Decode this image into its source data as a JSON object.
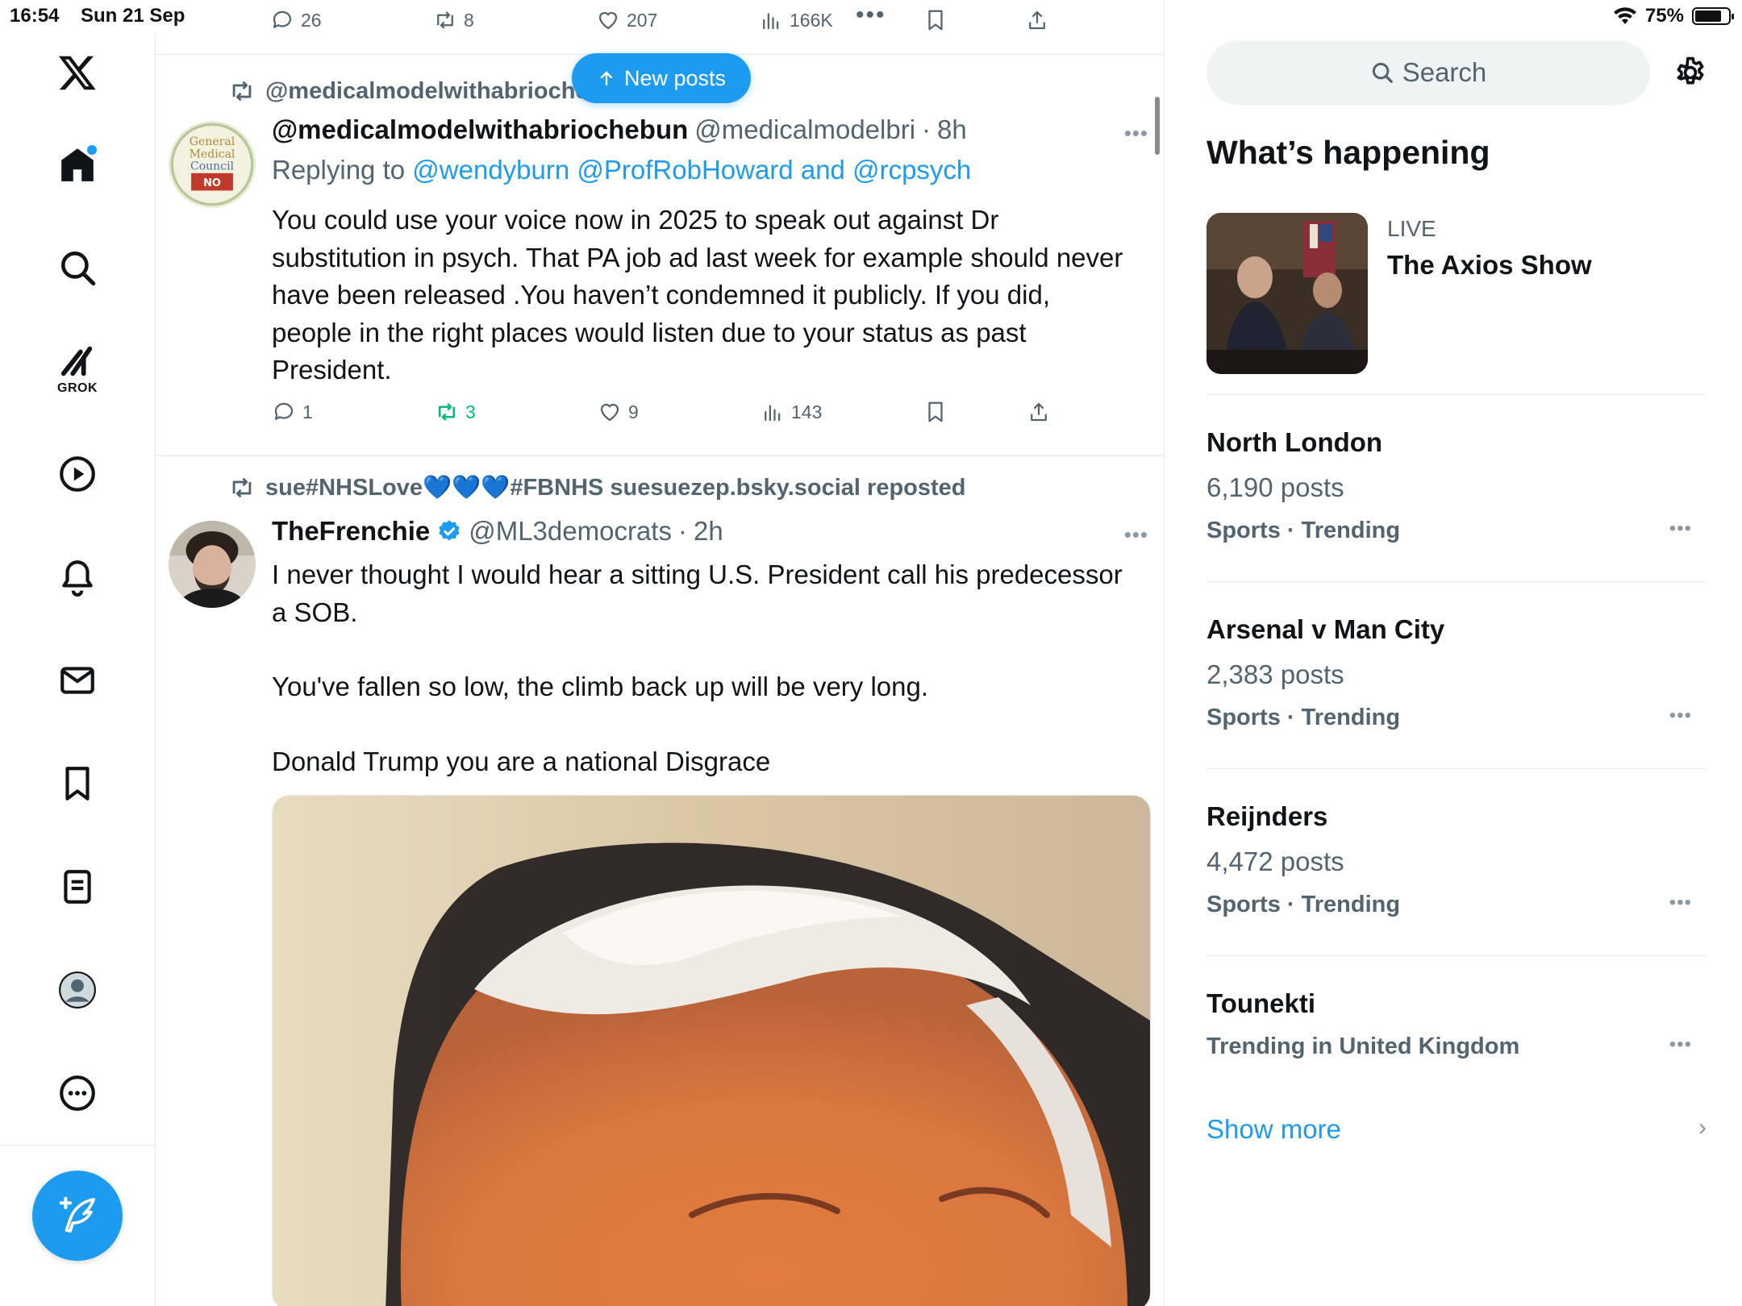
{
  "status_bar": {
    "time": "16:54",
    "date": "Sun 21 Sep",
    "battery": "75%"
  },
  "top_actions": {
    "replies": "26",
    "reposts": "8",
    "likes": "207",
    "views": "166K"
  },
  "new_posts": "New posts",
  "tweet1": {
    "repost_text": "@medicalmodelwithabriochebun reposted",
    "name": "@medicalmodelwithabriochebun",
    "handle": "@medicalmodelbri",
    "time": "8h",
    "replying_prefix": "Replying to",
    "replying_handles": "@wendyburn @ProfRobHoward",
    "replying_and": "and",
    "replying_last": "@rcpsych",
    "body": "You could use your voice now in 2025 to speak out against Dr substitution in psych. That PA job ad last week for example should never have been released .You haven’t condemned it publicly. If you did, people in the right places would listen due to your status as past President.",
    "replies": "1",
    "reposts": "3",
    "likes": "9",
    "views": "143",
    "avatar_text": [
      "General",
      "Medical",
      "Council",
      "NO"
    ]
  },
  "tweet2": {
    "repost_text": "sue#NHSLove💙💙💙#FBNHS suesuezep.bsky.social reposted",
    "name": "TheFrenchie",
    "handle": "@ML3democrats",
    "time": "2h",
    "body_line1": "I never thought I would hear a sitting U.S. President call his predecessor a SOB.",
    "body_line2": "You've fallen so low, the climb back up will be very long.",
    "body_line3": "Donald Trump you are a national Disgrace"
  },
  "sidebar": {
    "search_placeholder": "Search",
    "section_title": "What’s happening",
    "live": {
      "label": "LIVE",
      "title": "The Axios Show"
    },
    "trends": [
      {
        "name": "North London",
        "count": "6,190 posts",
        "category": "Sports · Trending"
      },
      {
        "name": "Arsenal v Man City",
        "count": "2,383 posts",
        "category": "Sports · Trending"
      },
      {
        "name": "Reijnders",
        "count": "4,472 posts",
        "category": "Sports · Trending"
      },
      {
        "name": "Tounekti",
        "count": "",
        "category": "Trending in United Kingdom"
      }
    ],
    "show_more": "Show more"
  },
  "nav": {
    "grok_label": "GROK",
    "icons": [
      "x-logo-icon",
      "home-icon",
      "search-icon",
      "grok-icon",
      "video-icon",
      "notifications-icon",
      "messages-icon",
      "bookmarks-icon",
      "lists-icon",
      "profile-icon",
      "more-icon"
    ]
  },
  "colors": {
    "accent": "#1d9bf0",
    "repost_green": "#00ba7c",
    "muted": "#536471"
  }
}
